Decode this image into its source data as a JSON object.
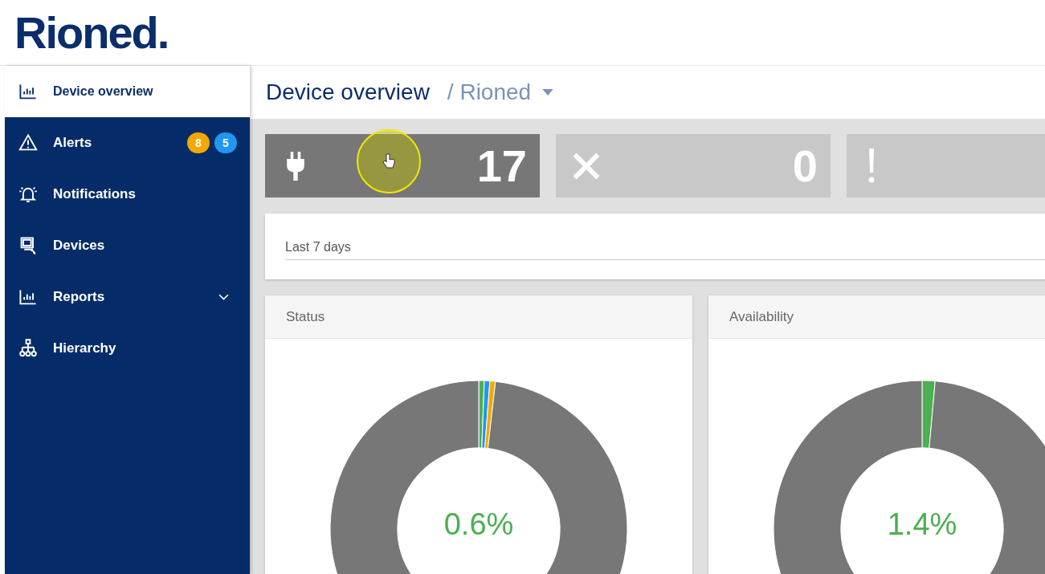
{
  "logo": "Rioned.",
  "sidebar": {
    "items": [
      {
        "label": "Device overview",
        "selected": true,
        "has_submenu": false
      },
      {
        "label": "Alerts",
        "selected": false,
        "has_submenu": false,
        "badges": [
          {
            "text": "8",
            "color": "#f5a800"
          },
          {
            "text": "5",
            "color": "#2196f3"
          }
        ]
      },
      {
        "label": "Notifications",
        "selected": false,
        "has_submenu": false
      },
      {
        "label": "Devices",
        "selected": false,
        "has_submenu": false
      },
      {
        "label": "Reports",
        "selected": false,
        "has_submenu": true
      },
      {
        "label": "Hierarchy",
        "selected": false,
        "has_submenu": false
      }
    ]
  },
  "header": {
    "title": "Device overview",
    "breadcrumb": "/ Rioned"
  },
  "tiles": [
    {
      "kind": "connected",
      "count": "17",
      "selected": true
    },
    {
      "kind": "error",
      "count": "0",
      "selected": false
    },
    {
      "kind": "warning",
      "selected": false
    }
  ],
  "filter": {
    "value": "Last 7 days"
  },
  "panels": [
    {
      "title": "Status",
      "center_value": "0.6%"
    },
    {
      "title": "Availability",
      "center_value": "1.4%"
    }
  ]
}
